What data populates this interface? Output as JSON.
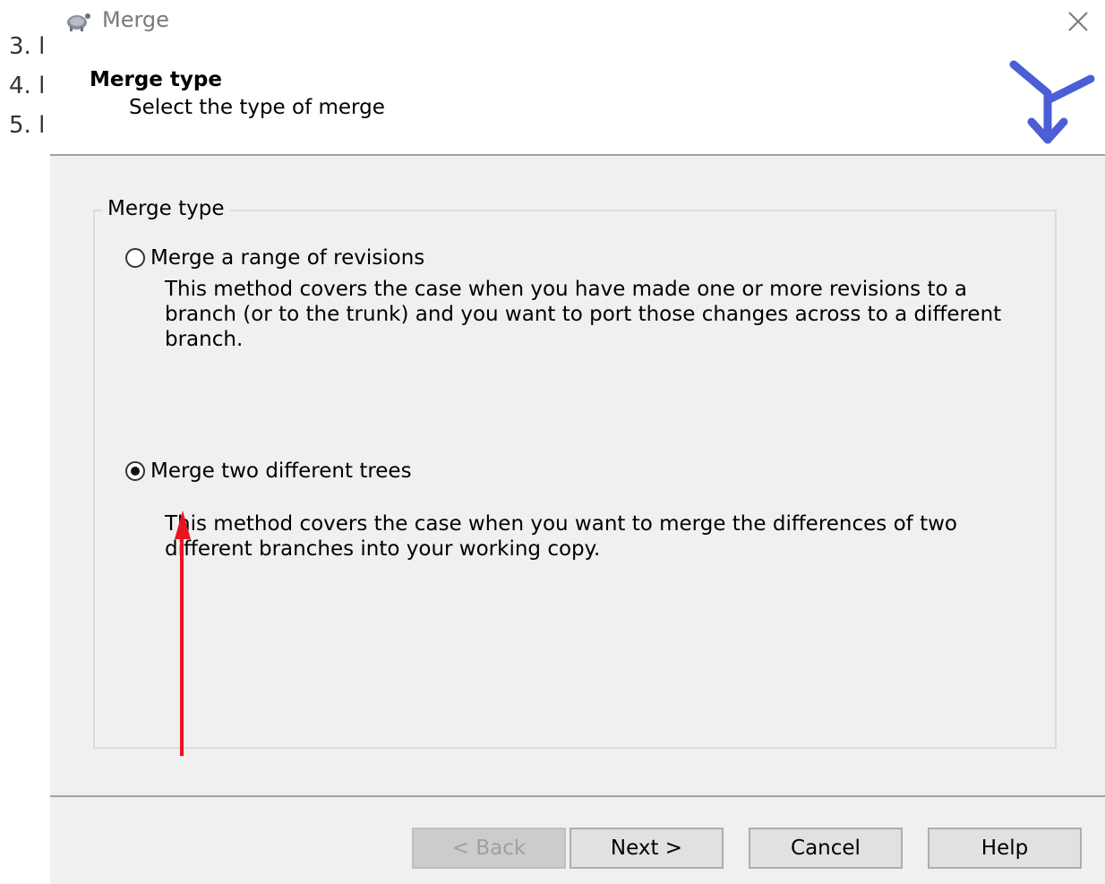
{
  "background_list": [
    "3. l",
    "4. l",
    "5. l"
  ],
  "window": {
    "title": "Merge",
    "app_icon": "tortoise-icon",
    "close_icon": "close-icon"
  },
  "header": {
    "title": "Merge type",
    "subtitle": "Select the type of merge",
    "logo_icon": "merge-arrow-icon"
  },
  "group": {
    "label": "Merge type",
    "options": [
      {
        "label": "Merge a range of revisions",
        "checked": false,
        "description": "This method covers the case when you have made one or more revisions to a branch (or to the trunk) and you want to port those changes across to a different branch."
      },
      {
        "label": "Merge two different trees",
        "checked": true,
        "description": "This method covers the case when you want to merge the differences of two different branches into your working copy."
      }
    ]
  },
  "annotation": {
    "icon": "red-arrow-icon",
    "color": "#e8141e"
  },
  "buttons": {
    "back": "< Back",
    "next": "Next >",
    "cancel": "Cancel",
    "help": "Help"
  },
  "colors": {
    "logo_blue": "#4a5fd6",
    "dialog_bg": "#f0f0f0"
  }
}
